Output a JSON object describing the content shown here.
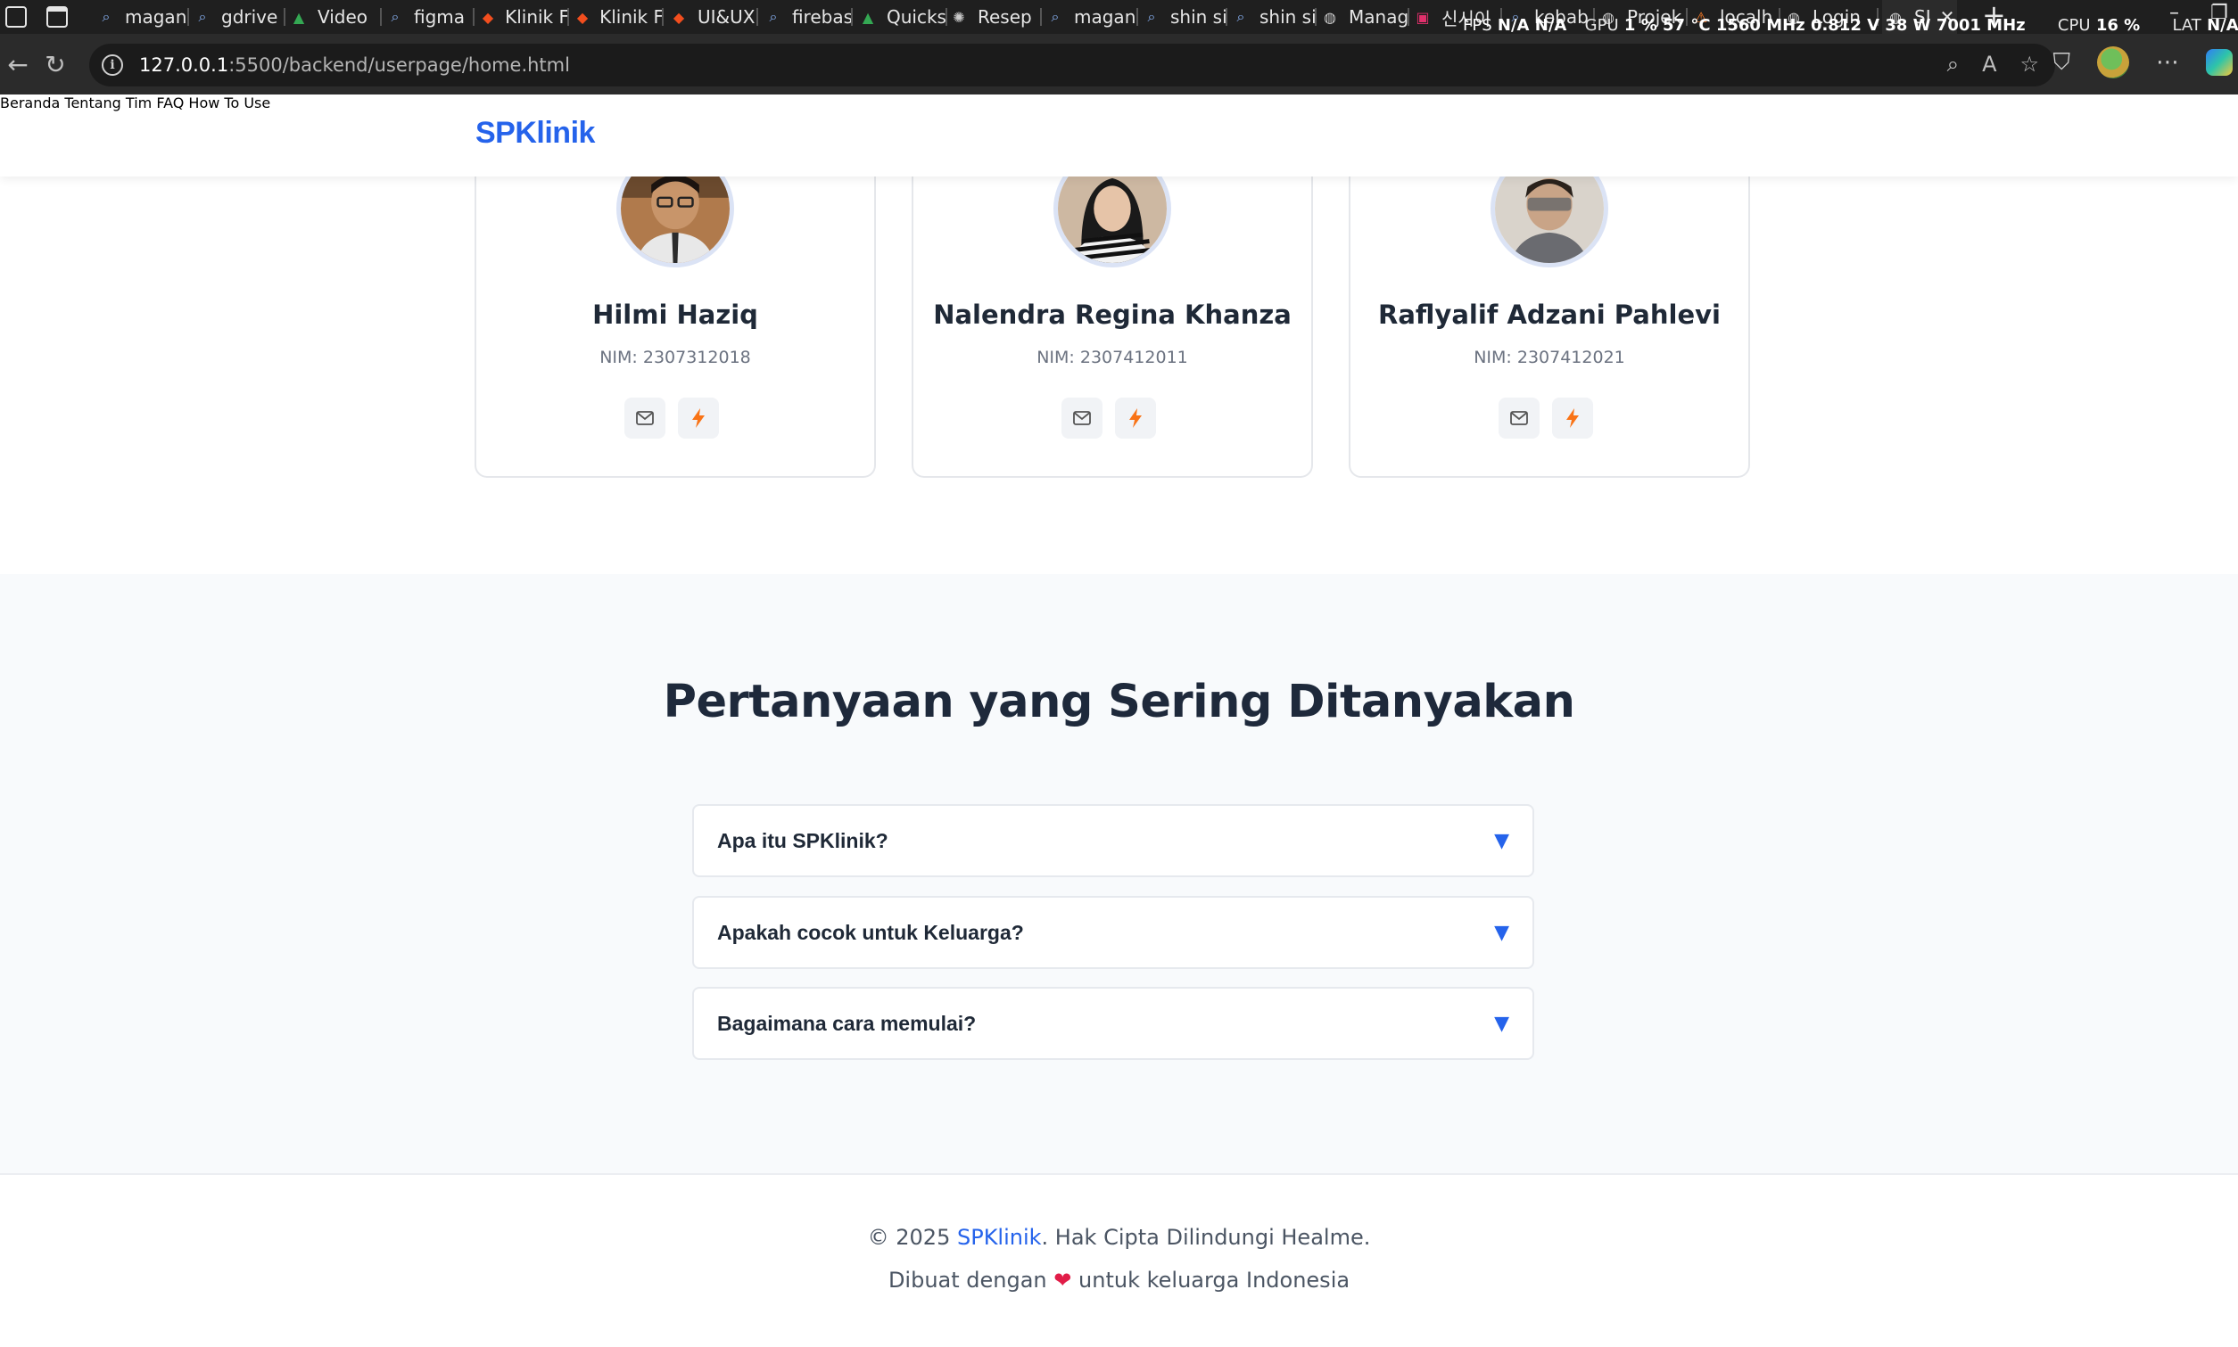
{
  "browser": {
    "tabs": [
      {
        "label": "magan",
        "icon": "search-icon"
      },
      {
        "label": "gdrive",
        "icon": "search-icon"
      },
      {
        "label": "Video",
        "icon": "drive-icon"
      },
      {
        "label": "figma",
        "icon": "search-icon"
      },
      {
        "label": "Klinik F",
        "icon": "figma-icon"
      },
      {
        "label": "Klinik F",
        "icon": "figma-icon"
      },
      {
        "label": "UI&UX",
        "icon": "figma-icon"
      },
      {
        "label": "firebas",
        "icon": "search-icon"
      },
      {
        "label": "Quicks",
        "icon": "drive-icon"
      },
      {
        "label": "Resep",
        "icon": "openai-icon"
      },
      {
        "label": "magan",
        "icon": "search-icon"
      },
      {
        "label": "shin si",
        "icon": "search-icon"
      },
      {
        "label": "shin si",
        "icon": "search-icon"
      },
      {
        "label": "Manag",
        "icon": "globe-icon"
      },
      {
        "label": "신시이",
        "icon": "instagram-icon"
      },
      {
        "label": "kebab",
        "icon": "search-icon"
      },
      {
        "label": "Projek",
        "icon": "globe-icon"
      },
      {
        "label": "localh",
        "icon": "xampp-icon"
      },
      {
        "label": "Login",
        "icon": "globe-icon"
      },
      {
        "label": "SI",
        "icon": "globe-icon"
      }
    ],
    "url_host": "127.0.0.1",
    "url_path": ":5500/backend/userpage/home.html",
    "overlay": {
      "fps_label": "FPS",
      "fps_value": "N/A",
      "fps_value2": "N/A",
      "gpu_label": "GPU",
      "gpu_value": "1 %",
      "gpu_temp": "57 °C",
      "gpu_clock": "1560 MHz",
      "gpu_volt": "0.812 V",
      "gpu_power": "38 W",
      "gpu_mem": "7001 MHz",
      "cpu_label": "CPU",
      "cpu_value": "16 %",
      "lat_label": "LAT",
      "lat_value": "N/A"
    }
  },
  "site": {
    "brand": "SPKlinik",
    "nav": [
      "Beranda",
      "Tentang",
      "Tim",
      "FAQ",
      "How To Use"
    ]
  },
  "team": [
    {
      "name": "Hilmi Haziq",
      "nim": "NIM: 2307312018"
    },
    {
      "name": "Nalendra Regina Khanza",
      "nim": "NIM: 2307412011"
    },
    {
      "name": "Raflyalif Adzani Pahlevi",
      "nim": "NIM: 2307412021"
    }
  ],
  "faq": {
    "title": "Pertanyaan yang Sering Ditanyakan",
    "items": [
      {
        "question": "Apa itu SPKlinik?"
      },
      {
        "question": "Apakah cocok untuk Keluarga?"
      },
      {
        "question": "Bagaimana cara memulai?"
      }
    ]
  },
  "footer": {
    "copyright_prefix": "© 2025 ",
    "brand": "SPKlinik",
    "copyright_suffix": ". Hak Cipta Dilindungi Healme.",
    "made_prefix": "Dibuat dengan ",
    "heart": "❤",
    "made_suffix": " untuk keluarga Indonesia"
  },
  "colors": {
    "brand": "#2563eb",
    "faq_bg": "#f8fafc",
    "text_dark": "#1f2937",
    "heart": "#e11d48"
  }
}
